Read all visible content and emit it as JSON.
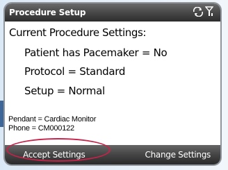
{
  "window": {
    "title": "Procedure Setup",
    "status_icons": [
      "sync-icon",
      "signal-icon"
    ]
  },
  "main": {
    "heading": "Current Procedure Settings:",
    "settings": [
      "Patient has Pacemaker = No",
      "Protocol = Standard",
      "Setup = Normal"
    ],
    "pendant": "Pendant = Cardiac Monitor",
    "phone": "Phone = CM000122"
  },
  "softkeys": {
    "left": "Accept Settings",
    "right": "Change Settings"
  },
  "colors": {
    "titlebar": "#4b4b4b",
    "highlight": "#c8224a",
    "background": "#dbe9f6"
  }
}
